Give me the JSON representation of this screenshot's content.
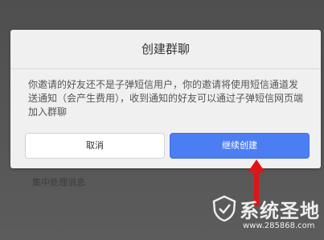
{
  "background": {
    "text": "集中处理消息"
  },
  "dialog": {
    "title": "创建群聊",
    "message": "你邀请的好友还不是子弹短信用户，你的邀请将使用短信通道发送通知（会产生费用），收到通知的好友可以通过子弹短信网页端加入群聊",
    "cancel_label": "取消",
    "confirm_label": "继续创建"
  },
  "watermark": {
    "brand": "系统圣地",
    "url": "www.285868.com"
  },
  "colors": {
    "primary": "#4c7ef3",
    "arrow": "#e01515"
  }
}
